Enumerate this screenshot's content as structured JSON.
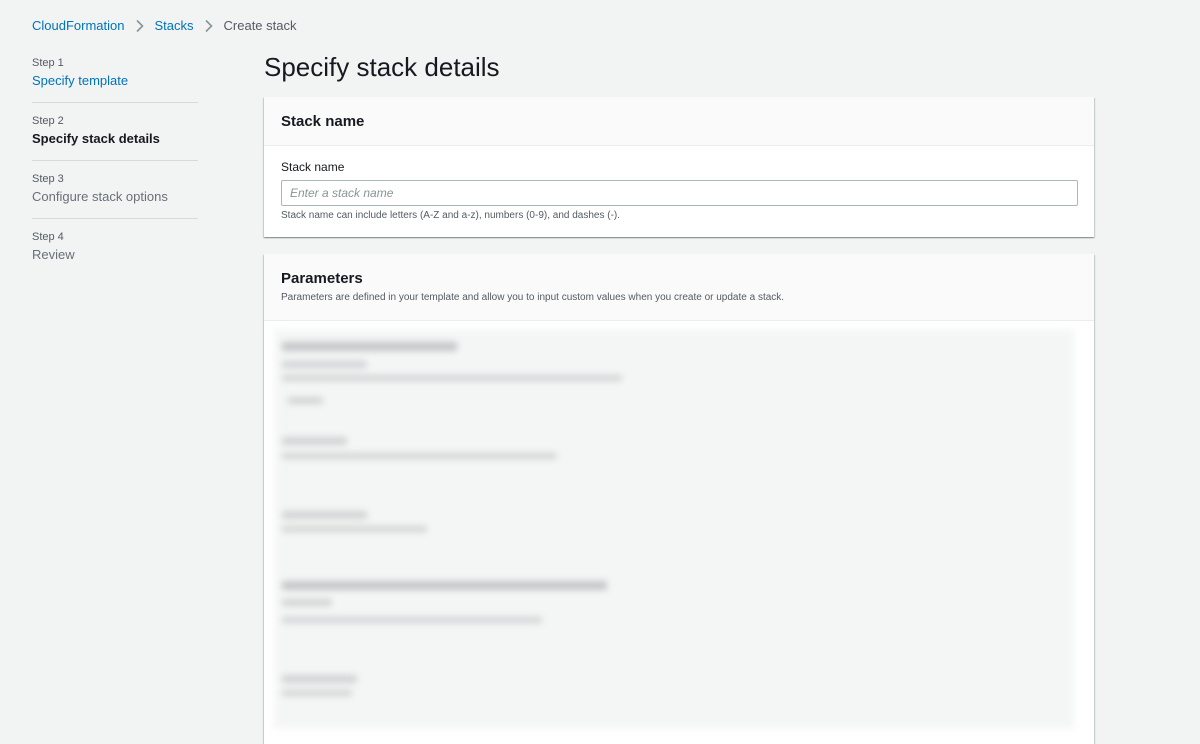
{
  "breadcrumb": {
    "items": [
      {
        "label": "CloudFormation"
      },
      {
        "label": "Stacks"
      },
      {
        "label": "Create stack"
      }
    ]
  },
  "steps": [
    {
      "number": "Step 1",
      "label": "Specify template",
      "state": "link"
    },
    {
      "number": "Step 2",
      "label": "Specify stack details",
      "state": "active"
    },
    {
      "number": "Step 3",
      "label": "Configure stack options",
      "state": "disabled"
    },
    {
      "number": "Step 4",
      "label": "Review",
      "state": "disabled"
    }
  ],
  "page": {
    "title": "Specify stack details"
  },
  "stack_name_section": {
    "title": "Stack name",
    "field_label": "Stack name",
    "placeholder": "Enter a stack name",
    "value": "",
    "hint": "Stack name can include letters (A-Z and a-z), numbers (0-9), and dashes (-)."
  },
  "parameters_section": {
    "title": "Parameters",
    "description": "Parameters are defined in your template and allow you to input custom values when you create or update a stack."
  },
  "colors": {
    "link": "#0073bb",
    "background": "#f2f3f3",
    "card_header": "#fafafa"
  },
  "icons": {
    "breadcrumb_separator": "chevron-right-icon"
  }
}
